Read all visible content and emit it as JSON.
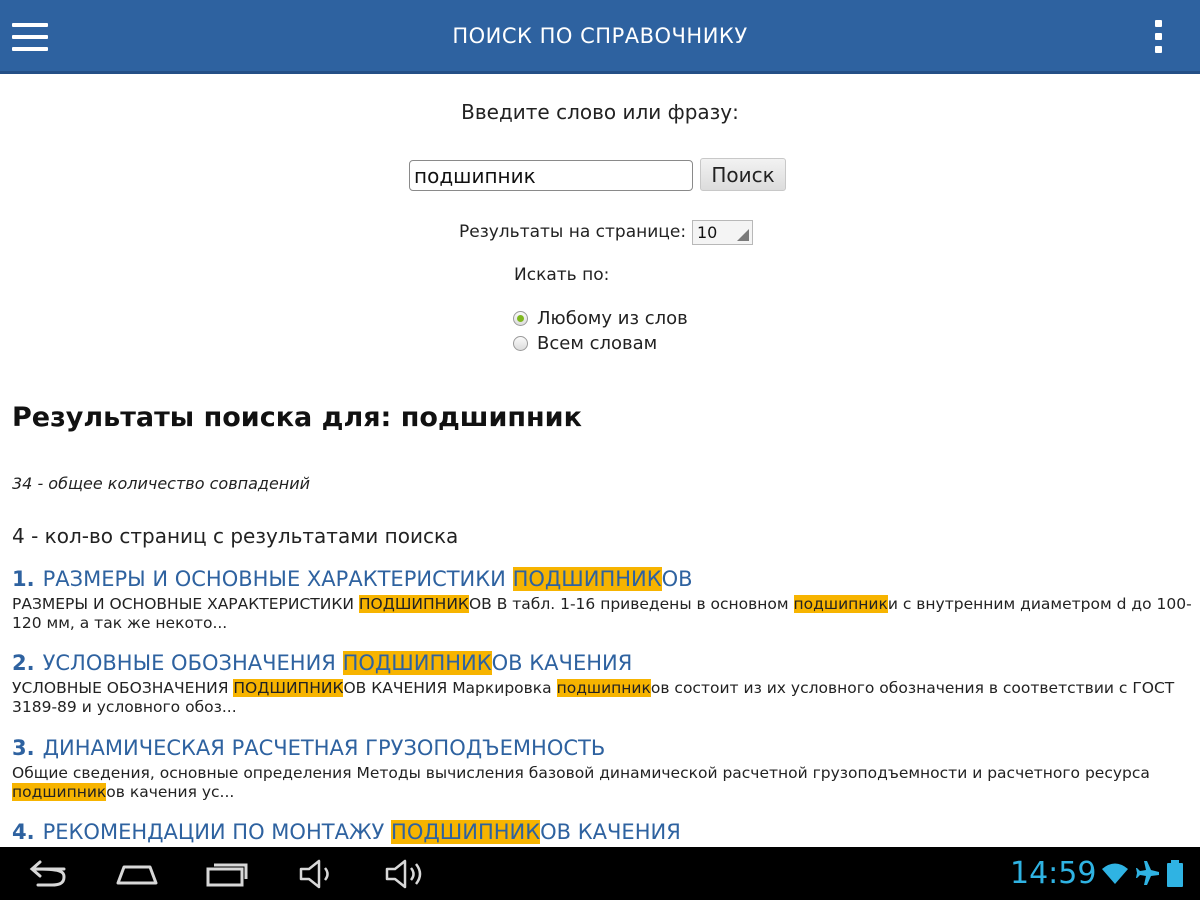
{
  "appbar": {
    "title": "ПОИСК ПО СПРАВОЧНИКУ"
  },
  "search": {
    "prompt": "Введите слово или фразу:",
    "query": "подшипник",
    "button_label": "Поиск",
    "per_page_label": "Результаты на странице:",
    "per_page_value": "10",
    "search_by_label": "Искать по:",
    "options": [
      {
        "label": "Любому из слов",
        "checked": true
      },
      {
        "label": "Всем словам",
        "checked": false
      }
    ]
  },
  "results": {
    "heading": "Результаты поиска для: подшипник",
    "total_text": "34 - общее количество совпадений",
    "pages_text": "4 - кол-во страниц с результатами поиска",
    "items": [
      {
        "num": "1.",
        "title": [
          {
            "t": "РАЗМЕРЫ И ОСНОВНЫЕ ХАРАКТЕРИСТИКИ ",
            "hl": false
          },
          {
            "t": "ПОДШИПНИК",
            "hl": true
          },
          {
            "t": "ОВ",
            "hl": false
          }
        ],
        "snippet": [
          {
            "t": "РАЗМЕРЫ И ОСНОВНЫЕ ХАРАКТЕРИСТИКИ ",
            "hl": false
          },
          {
            "t": "ПОДШИПНИК",
            "hl": true
          },
          {
            "t": "ОВ В табл. 1-16 приведены в основном ",
            "hl": false
          },
          {
            "t": "подшипник",
            "hl": true
          },
          {
            "t": "и с внутренним диаметром d до 100-120 мм, а так же некото...",
            "hl": false
          }
        ]
      },
      {
        "num": "2.",
        "title": [
          {
            "t": "УСЛОВНЫЕ ОБОЗНАЧЕНИЯ ",
            "hl": false
          },
          {
            "t": "ПОДШИПНИК",
            "hl": true
          },
          {
            "t": "ОВ КАЧЕНИЯ",
            "hl": false
          }
        ],
        "snippet": [
          {
            "t": "УСЛОВНЫЕ ОБОЗНАЧЕНИЯ ",
            "hl": false
          },
          {
            "t": "ПОДШИПНИК",
            "hl": true
          },
          {
            "t": "ОВ КАЧЕНИЯ Маркировка ",
            "hl": false
          },
          {
            "t": "подшипник",
            "hl": true
          },
          {
            "t": "ов состоит из их условного обозначения в соответствии с ГОСТ 3189-89 и условного обоз...",
            "hl": false
          }
        ]
      },
      {
        "num": "3.",
        "title": [
          {
            "t": "ДИНАМИЧЕСКАЯ РАСЧЕТНАЯ ГРУЗОПОДЪЕМНОСТЬ",
            "hl": false
          }
        ],
        "snippet": [
          {
            "t": "Общие сведения, основные определения Методы вычисления базовой динамической расчетной грузоподъемности и расчетного ресурса ",
            "hl": false
          },
          {
            "t": "подшипник",
            "hl": true
          },
          {
            "t": "ов качения ус...",
            "hl": false
          }
        ]
      },
      {
        "num": "4.",
        "title": [
          {
            "t": "РЕКОМЕНДАЦИИ ПО МОНТАЖУ ",
            "hl": false
          },
          {
            "t": "ПОДШИПНИК",
            "hl": true
          },
          {
            "t": "ОВ КАЧЕНИЯ",
            "hl": false
          }
        ],
        "snippet": []
      }
    ]
  },
  "status": {
    "clock": "14:59",
    "accent": "#2fb3e3"
  },
  "icons": {
    "appbar": [
      "menu-icon",
      "overflow-menu-icon"
    ],
    "navbar": [
      "back-icon",
      "home-icon",
      "recent-apps-icon",
      "volume-down-icon",
      "volume-up-icon"
    ],
    "status": [
      "wifi-icon",
      "airplane-icon",
      "battery-icon"
    ]
  },
  "colors": {
    "appbar": "#2e62a0",
    "link": "#2e62a0",
    "highlight": "#f7b400",
    "radio_checked": "#7fb81f"
  }
}
